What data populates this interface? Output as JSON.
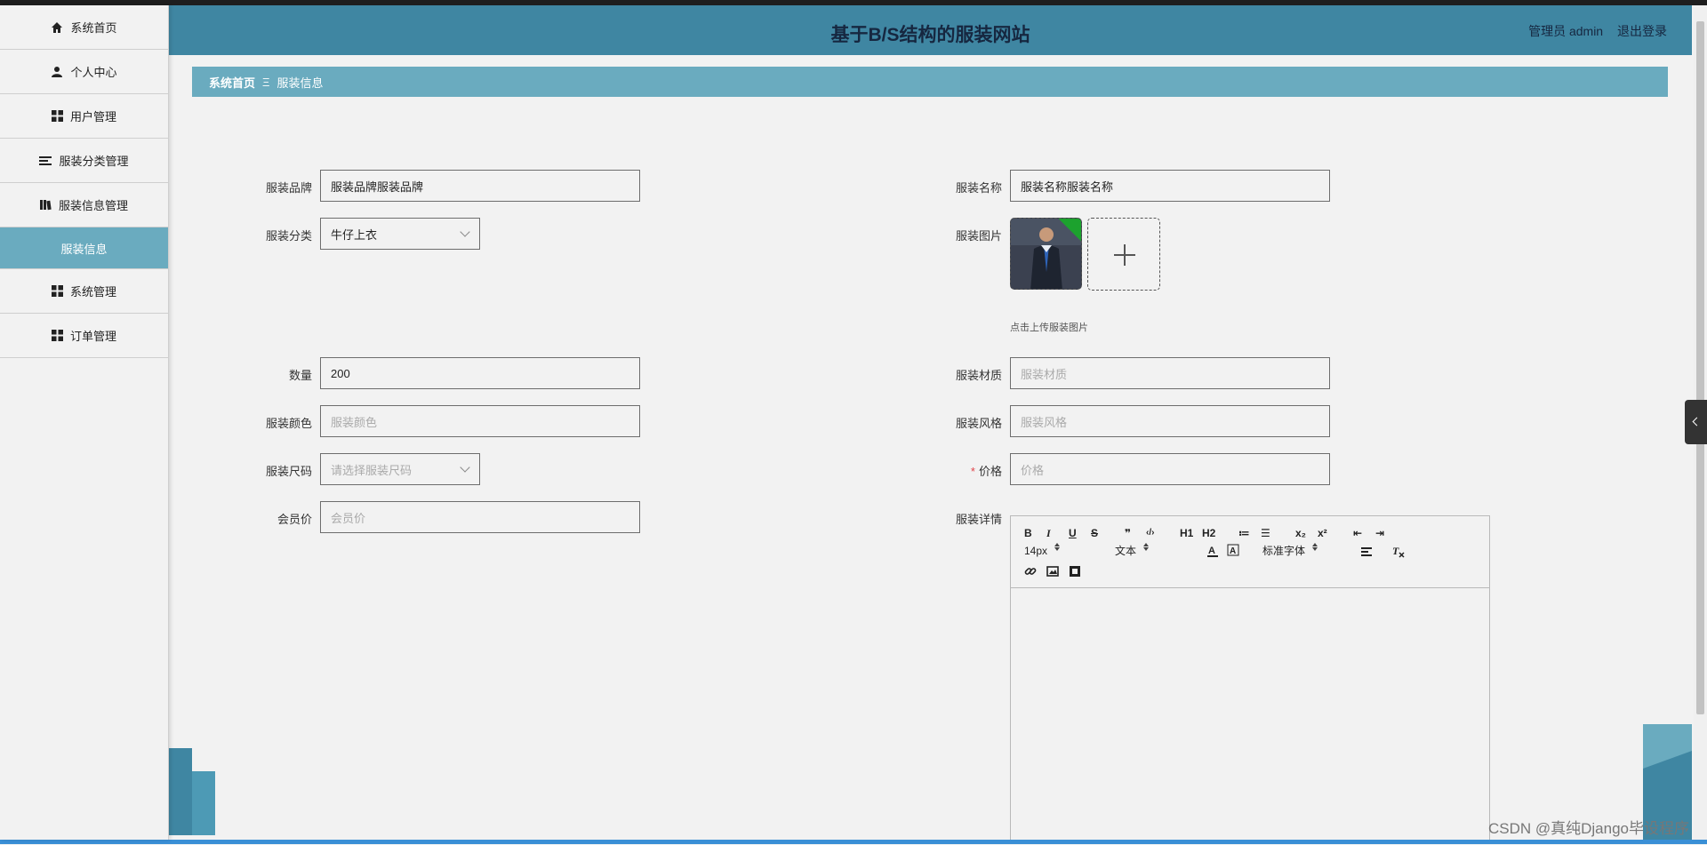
{
  "header": {
    "title": "基于B/S结构的服装网站",
    "user": "管理员 admin",
    "logout": "退出登录"
  },
  "sidebar": {
    "items": [
      {
        "label": "系统首页",
        "icon": "home-icon"
      },
      {
        "label": "个人中心",
        "icon": "person-icon"
      },
      {
        "label": "用户管理",
        "icon": "grid-icon"
      },
      {
        "label": "服装分类管理",
        "icon": "list-icon"
      },
      {
        "label": "服装信息管理",
        "icon": "book-icon"
      },
      {
        "label": "服装信息",
        "icon": ""
      },
      {
        "label": "系统管理",
        "icon": "grid-icon"
      },
      {
        "label": "订单管理",
        "icon": "grid-icon"
      }
    ]
  },
  "breadcrumb": {
    "home": "系统首页",
    "separator": "Ξ",
    "current": "服装信息"
  },
  "form": {
    "brand": {
      "label": "服装品牌",
      "value": "服装品牌服装品牌"
    },
    "name": {
      "label": "服装名称",
      "value": "服装名称服装名称"
    },
    "category": {
      "label": "服装分类",
      "value": "牛仔上衣"
    },
    "image": {
      "label": "服装图片",
      "hint": "点击上传服装图片"
    },
    "quantity": {
      "label": "数量",
      "value": "200"
    },
    "material": {
      "label": "服装材质",
      "placeholder": "服装材质"
    },
    "color": {
      "label": "服装颜色",
      "placeholder": "服装颜色"
    },
    "style": {
      "label": "服装风格",
      "placeholder": "服装风格"
    },
    "size": {
      "label": "服装尺码",
      "placeholder": "请选择服装尺码"
    },
    "price": {
      "label": "价格",
      "required_mark": "*",
      "placeholder": "价格"
    },
    "member_price": {
      "label": "会员价",
      "placeholder": "会员价"
    },
    "detail": {
      "label": "服装详情"
    }
  },
  "editor": {
    "row1": [
      "B",
      "I",
      "U",
      "S",
      "❞",
      "‹/›",
      "H1",
      "H2",
      "≔",
      "☰",
      "x₂",
      "x²",
      "⇤",
      "⇥"
    ],
    "font_size": "14px",
    "text_type": "文本",
    "font_family": "标准字体"
  },
  "watermark": "CSDN @真纯Django毕设程序"
}
